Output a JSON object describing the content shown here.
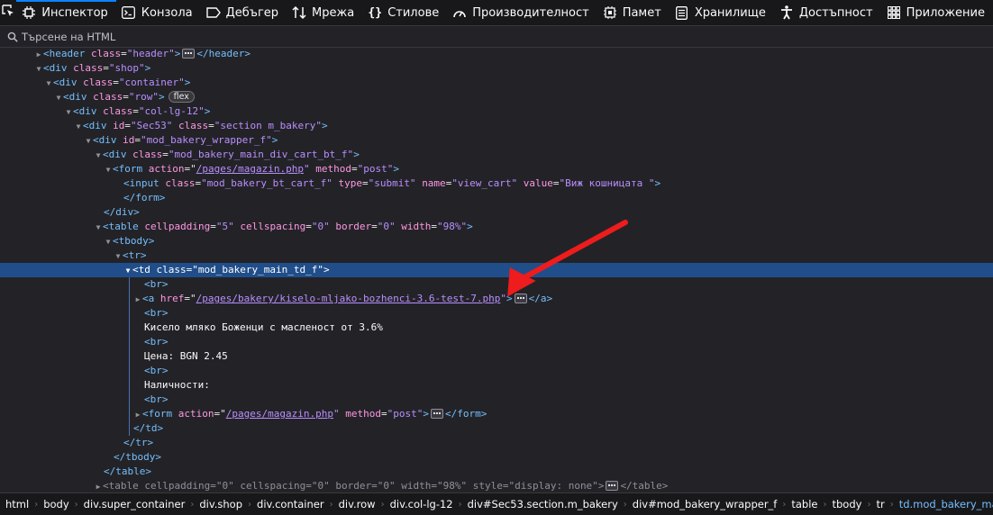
{
  "toolbar": {
    "pick_icon": "element-picker-icon",
    "tabs": [
      {
        "label": "Инспектор",
        "icon": "inspector-icon"
      },
      {
        "label": "Конзола",
        "icon": "console-icon"
      },
      {
        "label": "Дебъгер",
        "icon": "debugger-icon"
      },
      {
        "label": "Мрежа",
        "icon": "network-icon"
      },
      {
        "label": "Стилове",
        "icon": "style-editor-icon"
      },
      {
        "label": "Производителност",
        "icon": "performance-icon"
      },
      {
        "label": "Памет",
        "icon": "memory-icon"
      },
      {
        "label": "Хранилище",
        "icon": "storage-icon"
      },
      {
        "label": "Достъпност",
        "icon": "accessibility-icon"
      },
      {
        "label": "Приложение",
        "icon": "application-icon"
      }
    ],
    "active_tab": "Инспектор",
    "accent": "#0a84ff"
  },
  "search": {
    "placeholder": "Търсене на HTML",
    "value": ""
  },
  "tree": {
    "l1": {
      "tag": "<header",
      "attr": "class",
      "val": "\"header\"",
      "close": "</header>"
    },
    "l2": {
      "tag": "<div",
      "attr": "class",
      "val": "\"shop\""
    },
    "l3": {
      "tag": "<div",
      "attr": "class",
      "val": "\"container\""
    },
    "l4": {
      "tag": "<div",
      "attr": "class",
      "val": "\"row\"",
      "badge": "flex"
    },
    "l5": {
      "tag": "<div",
      "attr": "class",
      "val": "\"col-lg-12\""
    },
    "l6": {
      "tag": "<div",
      "a1": "id",
      "v1": "\"Sec53\"",
      "a2": "class",
      "v2": "\"section m_bakery\""
    },
    "l7": {
      "tag": "<div",
      "attr": "id",
      "val": "\"mod_bakery_wrapper_f\""
    },
    "l8": {
      "tag": "<div",
      "attr": "class",
      "val": "\"mod_bakery_main_div_cart_bt_f\""
    },
    "l9": {
      "tag": "<form",
      "a1": "action",
      "v1": "/pages/magazin.php",
      "a2": "method",
      "v2": "\"post\""
    },
    "l10": {
      "tag": "<input",
      "a1": "class",
      "v1": "\"mod_bakery_bt_cart_f\"",
      "a2": "type",
      "v2": "\"submit\"",
      "a3": "name",
      "v3": "\"view_cart\"",
      "a4": "value",
      "v4": "\"Виж кошницата \""
    },
    "l11": {
      "close": "</form>"
    },
    "l12": {
      "close": "</div>"
    },
    "l13": {
      "tag": "<table",
      "a1": "cellpadding",
      "v1": "\"5\"",
      "a2": "cellspacing",
      "v2": "\"0\"",
      "a3": "border",
      "v3": "\"0\"",
      "a4": "width",
      "v4": "\"98%\""
    },
    "l14": {
      "tag": "<tbody"
    },
    "l15": {
      "tag": "<tr"
    },
    "l16": {
      "tag": "<td",
      "attr": "class",
      "val": "\"mod_bakery_main_td_f\""
    },
    "l17": {
      "tag": "<br>"
    },
    "l18": {
      "tag": "<a",
      "attr": "href",
      "val": "/pages/bakery/kiselo-mljako-bozhenci-3.6-test-7.php",
      "close": "</a>"
    },
    "l19": {
      "tag": "<br>"
    },
    "l20": {
      "text": "Кисело мляко Боженци с масленост от 3.6%"
    },
    "l21": {
      "tag": "<br>"
    },
    "l22": {
      "text": "Цена: BGN 2.45"
    },
    "l23": {
      "tag": "<br>"
    },
    "l24": {
      "text": "Наличности:"
    },
    "l25": {
      "tag": "<br>"
    },
    "l26": {
      "tag": "<form",
      "a1": "action",
      "v1": "/pages/magazin.php",
      "a2": "method",
      "v2": "\"post\"",
      "close": "</form>"
    },
    "l27": {
      "close": "</td>"
    },
    "l28": {
      "close": "</tr>"
    },
    "l29": {
      "close": "</tbody>"
    },
    "l30": {
      "close": "</table>"
    },
    "l31": {
      "tag": "<table",
      "a1": "cellpadding",
      "v1": "\"0\"",
      "a2": "cellspacing",
      "v2": "\"0\"",
      "a3": "border",
      "v3": "\"0\"",
      "a4": "width",
      "v4": "\"98%\"",
      "a5": "style",
      "v5": "\"display: none\"",
      "close": "</table>"
    }
  },
  "breadcrumbs": [
    "html",
    "body",
    "div.super_container",
    "div.shop",
    "div.container",
    "div.row",
    "div.col-lg-12",
    "div#Sec53.section.m_bakery",
    "div#mod_bakery_wrapper_f",
    "table",
    "tbody",
    "tr",
    "td.mod_bakery_main_td_f"
  ],
  "colors": {
    "selection": "#204e8a",
    "tag": "#75bfff",
    "attr_name": "#ff97e3",
    "attr_value": "#b98eff",
    "annotation_arrow": "#ee1c1c"
  }
}
